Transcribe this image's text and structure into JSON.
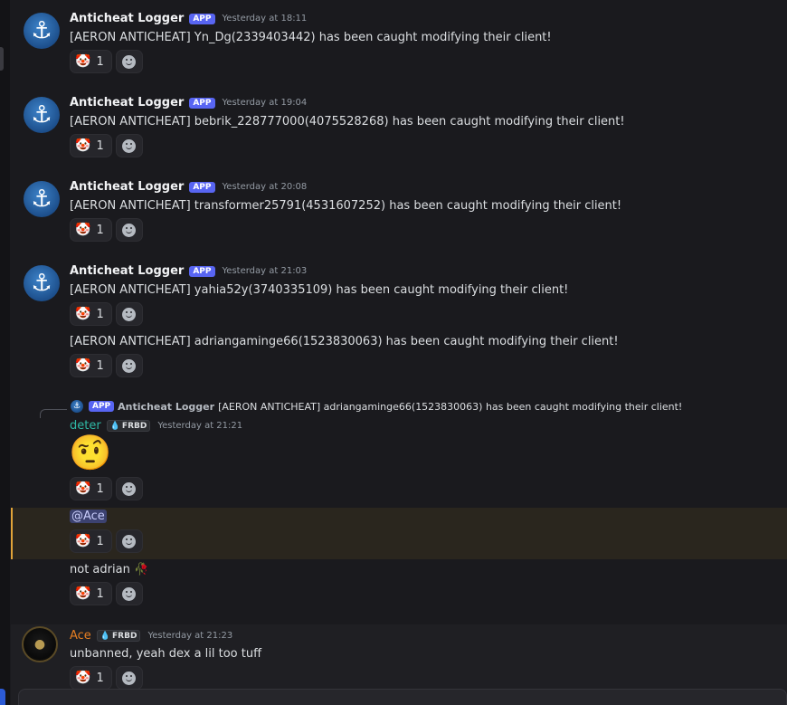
{
  "messages": [
    {
      "author": "Anticheat Logger",
      "tag": "APP",
      "time": "Yesterday at 18:11",
      "text": "[AERON ANTICHEAT] Yn_Dg(2339403442) has been caught modifying their client!",
      "reaction": {
        "emoji": "🤡",
        "count": "1"
      }
    },
    {
      "author": "Anticheat Logger",
      "tag": "APP",
      "time": "Yesterday at 19:04",
      "text": "[AERON ANTICHEAT] bebrik_228777000(4075528268) has been caught modifying their client!",
      "reaction": {
        "emoji": "🤡",
        "count": "1"
      }
    },
    {
      "author": "Anticheat Logger",
      "tag": "APP",
      "time": "Yesterday at 20:08",
      "text": "[AERON ANTICHEAT] transformer25791(4531607252) has been caught modifying their client!",
      "reaction": {
        "emoji": "🤡",
        "count": "1"
      }
    },
    {
      "author": "Anticheat Logger",
      "tag": "APP",
      "time": "Yesterday at 21:03",
      "text": "[AERON ANTICHEAT] yahia52y(3740335109) has been caught modifying their client!",
      "reaction": {
        "emoji": "🤡",
        "count": "1"
      }
    },
    {
      "text": "[AERON ANTICHEAT] adriangaminge66(1523830063) has been caught modifying their client!",
      "reaction": {
        "emoji": "🤡",
        "count": "1"
      }
    }
  ],
  "reply": {
    "tag": "APP",
    "author": "Anticheat Logger",
    "text": "[AERON ANTICHEAT] adriangaminge66(1523830063) has been caught modifying their client!"
  },
  "deter": {
    "author": "deter",
    "guild_tag": "FRBD",
    "time": "Yesterday at 21:21",
    "emoji": "🤨",
    "reaction": {
      "emoji": "🤡",
      "count": "1"
    }
  },
  "mention_msg": {
    "mention": "@Ace",
    "reaction": {
      "emoji": "🤡",
      "count": "1"
    }
  },
  "adrian_msg": {
    "text": "not adrian",
    "emoji": "🥀",
    "reaction": {
      "emoji": "🤡",
      "count": "1"
    }
  },
  "ace": {
    "author": "Ace",
    "guild_tag": "FRBD",
    "time": "Yesterday at 21:23",
    "text": "unbanned, yeah dex a lil too tuff",
    "reaction": {
      "emoji": "🤡",
      "count": "1"
    }
  },
  "colors": {
    "app_tag": "#5865f2",
    "deter_name": "#2fb8a5",
    "ace_name": "#e67e22",
    "mention_bar": "#e0a339"
  },
  "icons": {
    "avatar": "anchor-icon",
    "add_reaction": "smiley-icon",
    "guild": "droplet-icon"
  }
}
